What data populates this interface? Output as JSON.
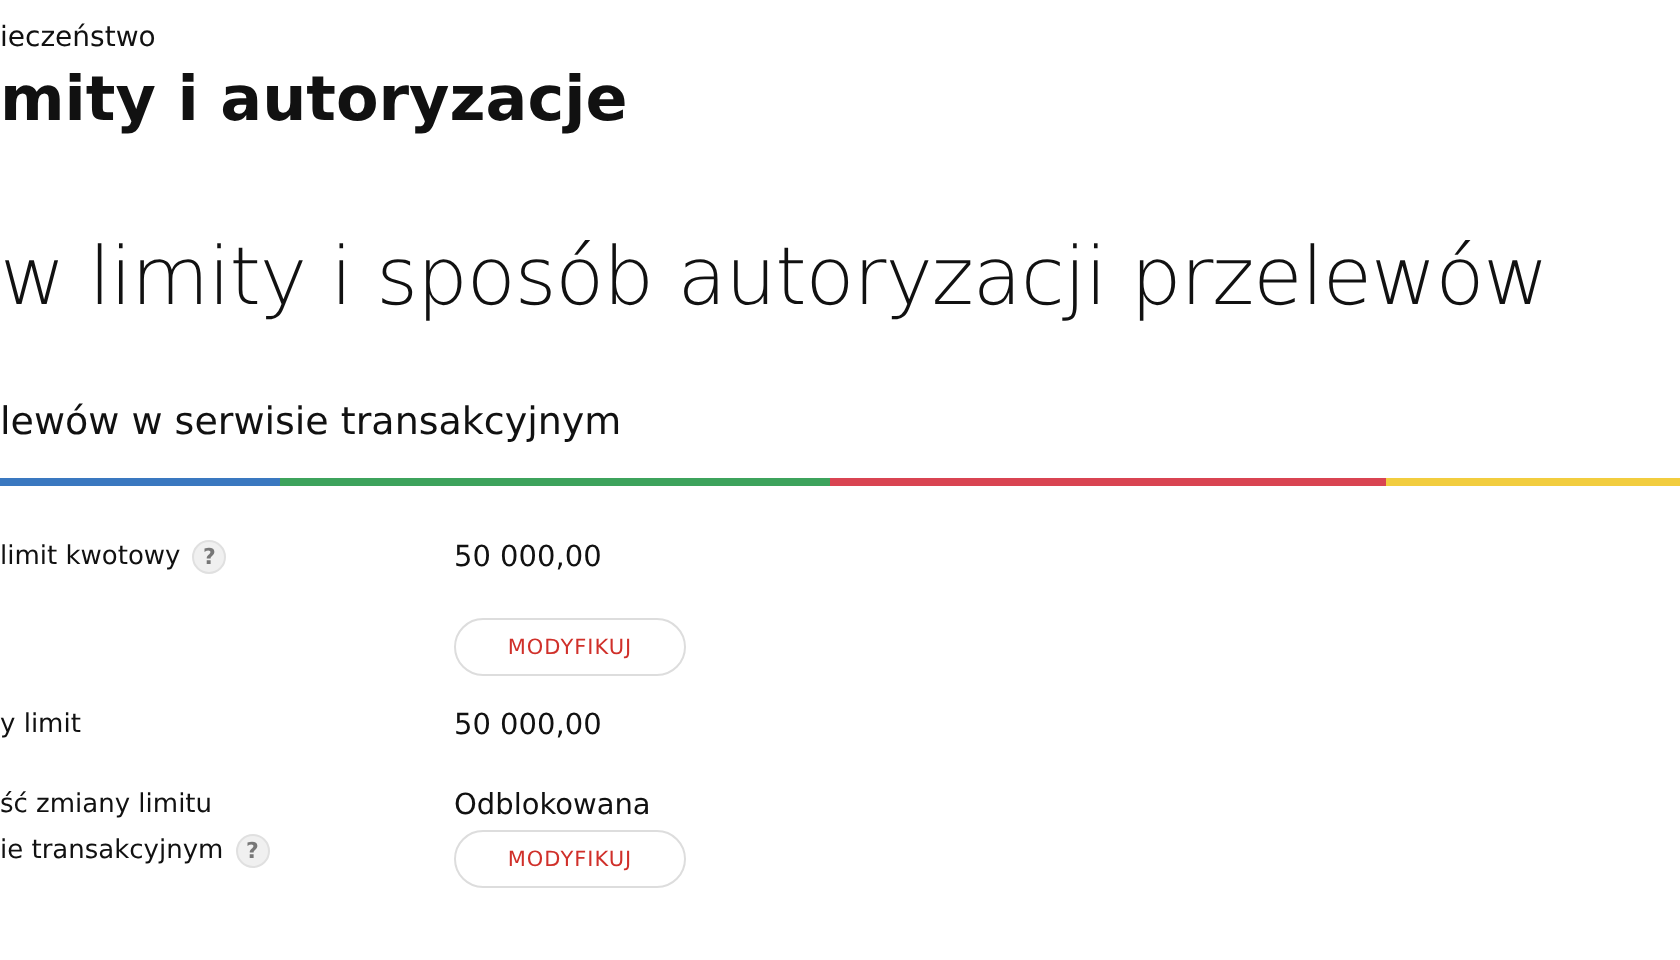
{
  "breadcrumb": "ieczeństwo",
  "title": "mity i autoryzacje",
  "heading": "w limity i sposób autoryzacji przelewów",
  "section_title": "lewów w serwisie transakcyjnym",
  "rows": [
    {
      "label_lines": [
        "limit kwotowy"
      ],
      "help": true,
      "value": "50 000,00",
      "button": "MODYFIKUJ"
    },
    {
      "label_lines": [
        "y limit"
      ],
      "help": false,
      "value": "50 000,00"
    },
    {
      "label_lines": [
        "ść zmiany limitu",
        "ie transakcyjnym"
      ],
      "help": true,
      "value": "Odblokowana",
      "button": "MODYFIKUJ"
    }
  ],
  "help_mark": "?"
}
